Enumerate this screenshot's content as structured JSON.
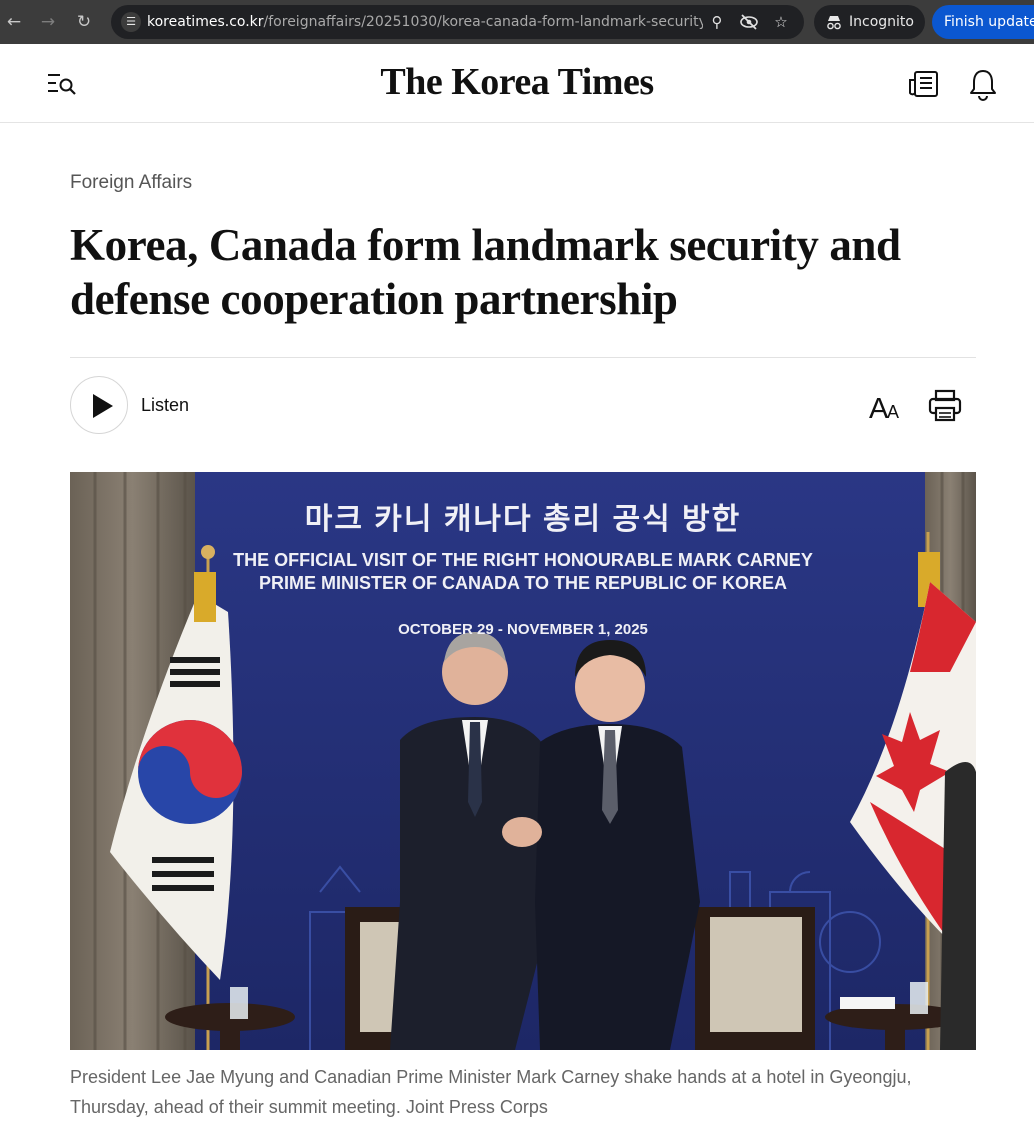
{
  "browser": {
    "url_host": "koreatimes.co.kr",
    "url_path": "/foreignaffairs/20251030/korea-canada-form-landmark-security-an...",
    "incognito_label": "Incognito",
    "update_label": "Finish update"
  },
  "header": {
    "logo_text": "The Korea Times"
  },
  "article": {
    "section": "Foreign Affairs",
    "headline": "Korea, Canada form landmark security and defense cooperation partnership",
    "listen_label": "Listen",
    "font_size_label": "AA",
    "caption": "President Lee Jae Myung and Canadian Prime Minister Mark Carney shake hands at a hotel in Gyeongju, Thursday, ahead of their summit meeting. Joint Press Corps"
  },
  "photo": {
    "banner_korean": "마크 카니 캐나다 총리 공식 방한",
    "banner_line1": "THE OFFICIAL VISIT OF THE RIGHT HONOURABLE MARK CARNEY",
    "banner_line2": "PRIME MINISTER OF CANADA TO THE REPUBLIC OF KOREA",
    "banner_dates": "OCTOBER 29 - NOVEMBER 1, 2025"
  },
  "colors": {
    "chrome_bg": "#3c3c3c",
    "omnibox_bg": "#202124",
    "update_blue": "#0b57d0",
    "backdrop_navy": "#2c3a86",
    "text_primary": "#111111",
    "text_muted": "#666666"
  },
  "icons": {
    "back": "arrow-left-icon",
    "forward": "arrow-right-icon",
    "reload": "reload-icon",
    "site_info": "tune-icon",
    "zoom": "zoom-icon",
    "tracking": "eye-off-icon",
    "bookmark": "star-icon",
    "incognito": "incognito-icon",
    "menu": "menu-search-icon",
    "newspaper": "newspaper-icon",
    "notifications": "bell-icon",
    "play": "play-icon",
    "font_size": "font-size-icon",
    "print": "printer-icon"
  }
}
